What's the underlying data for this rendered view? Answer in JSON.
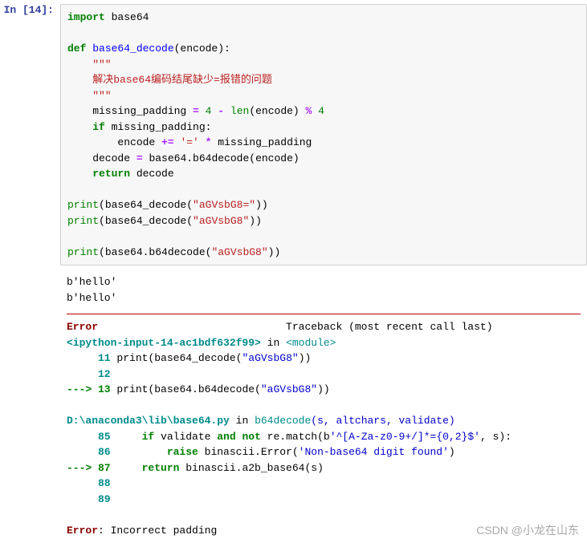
{
  "prompt": "In [14]:",
  "code": {
    "l1": {
      "kw": "import",
      "rest": " base64"
    },
    "l2": "",
    "l3": {
      "kw": "def",
      "nf": " base64_decode",
      "args": "(encode):"
    },
    "l4": {
      "doc": "    \"\"\""
    },
    "l5": {
      "doc": "    解决base64编码结尾缺少=报错的问题"
    },
    "l6": {
      "doc": "    \"\"\""
    },
    "l7": {
      "pre": "    missing_padding ",
      "eq": "=",
      "mid": " ",
      "n4": "4",
      "sp": " ",
      "mn": "-",
      "sp2": " ",
      "len": "len",
      "args2": "(encode) ",
      "pct": "%",
      "sp3": " ",
      "n4b": "4"
    },
    "l8": {
      "pre": "    ",
      "kw": "if",
      "rest": " missing_padding:"
    },
    "l9": {
      "pre": "        encode ",
      "peq": "+=",
      "sp": " ",
      "s": "'='",
      "sp2": " ",
      "st": "*",
      "rest": " missing_padding"
    },
    "l10": {
      "pre": "    decode ",
      "eq": "=",
      "rest": " base64.b64decode(encode)"
    },
    "l11": {
      "pre": "    ",
      "kw": "return",
      "rest": " decode"
    },
    "l12": "",
    "l13": {
      "pr": "print",
      "op": "(base64_decode(",
      "s": "\"aGVsbG8=\"",
      "cp": "))"
    },
    "l14": {
      "pr": "print",
      "op": "(base64_decode(",
      "s": "\"aGVsbG8\"",
      "cp": "))"
    },
    "l15": "",
    "l16": {
      "pr": "print",
      "op": "(base64.b64decode(",
      "s": "\"aGVsbG8\"",
      "cp": "))"
    }
  },
  "stdout": {
    "l1": "b'hello'",
    "l2": "b'hello'"
  },
  "tb": {
    "head_err": "Error",
    "head_txt": "                              Traceback (most recent call last)",
    "r1_a": "<ipython-input-14-ac1bdf632f99>",
    "r1_b": " in ",
    "r1_c": "<module>",
    "r2_a": "     11 ",
    "r2_b": "print",
    "r2_c": "(base64_decode(",
    "r2_d": "\"aGVsbG8\"",
    "r2_e": "))",
    "r3": "     12",
    "r4_a": "---> 13 ",
    "r4_b": "print",
    "r4_c": "(base64.b64decode(",
    "r4_d": "\"aGVsbG8\"",
    "r4_e": "))",
    "blank1": "",
    "f1_a": "D:\\anaconda3\\lib\\base64.py",
    "f1_b": " in ",
    "f1_c": "b64decode",
    "f1_d": "(s, altchars, validate)",
    "f2_a": "     85     ",
    "f2_b": "if",
    "f2_c": " validate ",
    "f2_d": "and",
    "f2_e": " ",
    "f2_f": "not",
    "f2_g": " re.match(b",
    "f2_h": "'^[A-Za-z0-9+/]*={0,2}$'",
    "f2_i": ", s):",
    "f3_a": "     86         ",
    "f3_b": "raise",
    "f3_c": " binascii.Error(",
    "f3_d": "'Non-base64 digit found'",
    "f3_e": ")",
    "f4_a": "---> 87     ",
    "f4_b": "return",
    "f4_c": " binascii.a2b_base64(s)",
    "f5": "     88",
    "f6": "     89",
    "blank2": "",
    "fin_a": "Error",
    "fin_b": ": Incorrect padding"
  },
  "watermark": "CSDN @小龙在山东",
  "chart_data": {
    "type": "table",
    "description": "Jupyter notebook code cell In[14] with Python code defining base64_decode function, followed by stdout output and a traceback error.",
    "code_lines": [
      "import base64",
      "",
      "def base64_decode(encode):",
      "    \"\"\"",
      "    解决base64编码结尾缺少=报错的问题",
      "    \"\"\"",
      "    missing_padding = 4 - len(encode) % 4",
      "    if missing_padding:",
      "        encode += '=' * missing_padding",
      "    decode = base64.b64decode(encode)",
      "    return decode",
      "",
      "print(base64_decode(\"aGVsbG8=\"))",
      "print(base64_decode(\"aGVsbG8\"))",
      "",
      "print(base64.b64decode(\"aGVsbG8\"))"
    ],
    "stdout": [
      "b'hello'",
      "b'hello'"
    ],
    "error": "Error: Incorrect padding"
  }
}
